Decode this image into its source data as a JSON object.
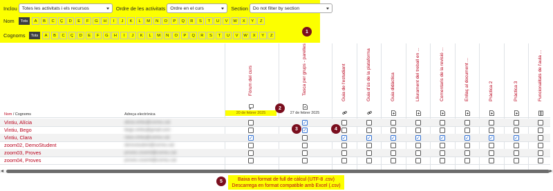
{
  "filters": {
    "include_label": "Inclou",
    "include_value": "Totes les activitats i els recursos",
    "order_label": "Ordre de les activitats",
    "order_value": "Ordre en el curs",
    "section_label": "Section",
    "section_value": "Do not filter by section"
  },
  "first_name_filter": {
    "label": "Nom",
    "all_label": "Tots",
    "letters": [
      "A",
      "B",
      "C",
      "Ç",
      "D",
      "E",
      "F",
      "G",
      "H",
      "I",
      "J",
      "K",
      "L",
      "M",
      "N",
      "O",
      "P",
      "Q",
      "R",
      "S",
      "T",
      "U",
      "V",
      "W",
      "X",
      "Y",
      "Z"
    ]
  },
  "last_name_filter": {
    "label": "Cognoms",
    "all_label": "Tots",
    "letters": [
      "A",
      "B",
      "C",
      "Ç",
      "D",
      "E",
      "F",
      "G",
      "H",
      "I",
      "J",
      "K",
      "L",
      "M",
      "N",
      "O",
      "P",
      "Q",
      "R",
      "S",
      "T",
      "U",
      "V",
      "W",
      "X",
      "Y",
      "Z"
    ]
  },
  "callouts": [
    "1",
    "2",
    "3",
    "4",
    "5"
  ],
  "table": {
    "header_name": "Nom",
    "header_sep": " / ",
    "header_surname": "Cognoms",
    "header_email": "Adreça electrònica",
    "columns": [
      {
        "title": "Fòrum del curs",
        "icon": "forum-icon",
        "date": "20 de febrer 2025",
        "date_highlight": true
      },
      {
        "title": "Tasca per grups - parelles",
        "icon": "assignment-icon",
        "date": "27 de febrer 2025",
        "date_highlight": false
      },
      {
        "title": "Guia de l'estudiant",
        "icon": "link-icon",
        "date": "",
        "date_highlight": false
      },
      {
        "title": "Guia d'ús de la plataforma",
        "icon": "link-icon",
        "date": "",
        "date_highlight": false
      },
      {
        "title": "Guia didàctica",
        "icon": "file-icon",
        "date": "",
        "date_highlight": false
      },
      {
        "title": "Lliurament del treball en ...",
        "icon": "file-icon",
        "date": "",
        "date_highlight": false
      },
      {
        "title": "Comentaris de la revisió ...",
        "icon": "file-icon",
        "date": "",
        "date_highlight": false
      },
      {
        "title": "Enllaç al document ...",
        "icon": "file-icon",
        "date": "",
        "date_highlight": false
      },
      {
        "title": "Pràctica 2",
        "icon": "file-icon",
        "date": "",
        "date_highlight": false
      },
      {
        "title": "Pràctica 3",
        "icon": "file-icon",
        "date": "",
        "date_highlight": false
      },
      {
        "title": "Funcionalitats de l'aula ...",
        "icon": "book-icon",
        "date": "",
        "date_highlight": false
      }
    ],
    "rows": [
      {
        "name": "Vintiu, Alícia",
        "email": "alicia.vintiu@correu.cat",
        "checks": [
          false,
          true,
          false,
          false,
          false,
          false,
          false,
          false,
          false,
          false,
          false
        ]
      },
      {
        "name": "Vintiu, Bego",
        "email": "bego.vintiu@gmail.com",
        "checks": [
          false,
          true,
          false,
          false,
          false,
          false,
          false,
          false,
          false,
          false,
          false
        ]
      },
      {
        "name": "Vintiu, Clara",
        "email": "clara.vintiu@correu.cat",
        "checks": [
          true,
          false,
          true,
          true,
          true,
          true,
          true,
          true,
          true,
          true,
          false
        ]
      },
      {
        "name": "zoom02, DemoStudent",
        "email": "demostudent@correu.cat",
        "checks": [
          false,
          false,
          false,
          false,
          false,
          false,
          false,
          false,
          false,
          false,
          false
        ]
      },
      {
        "name": "zoom03, Proves",
        "email": "proves.zoom3@correu.cat",
        "checks": [
          false,
          false,
          false,
          false,
          false,
          false,
          false,
          false,
          false,
          false,
          false
        ]
      },
      {
        "name": "zoom04, Proves",
        "email": "proves.zoom4@correu.cat",
        "checks": [
          false,
          false,
          false,
          false,
          false,
          false,
          false,
          false,
          false,
          false,
          false
        ]
      }
    ]
  },
  "downloads": {
    "csv_utf8": "Baixa en format de full de càlcul (UTF-8 .csv)",
    "csv_excel": "Descarrega en format compatible amb Excel (.csv)"
  }
}
